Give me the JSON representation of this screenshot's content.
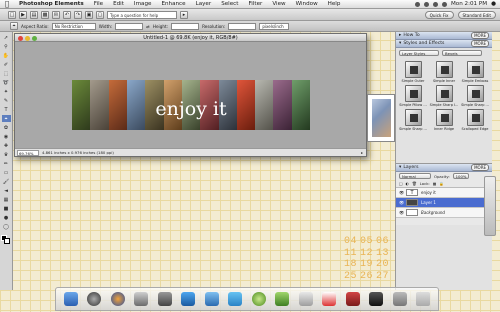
{
  "menubar": {
    "app_name": "Photoshop Elements",
    "items": [
      "File",
      "Edit",
      "Image",
      "Enhance",
      "Layer",
      "Select",
      "Filter",
      "View",
      "Window",
      "Help"
    ],
    "clock": "Mon 2:01 PM"
  },
  "shortcuts": {
    "help_placeholder": "Type a question for help",
    "quick_fix": "Quick Fix",
    "standard_edit": "Standard Edit"
  },
  "options_bar": {
    "aspect_ratio_label": "Aspect Ratio:",
    "aspect_ratio_value": "No Restriction",
    "width_label": "Width:",
    "height_label": "Height:",
    "resolution_label": "Resolution:",
    "resolution_unit": "pixels/inch",
    "clear_button": "Clear"
  },
  "document": {
    "title": "Untitled-1 @ 69.8K (enjoy it, RGB/8#)",
    "text_layer": "enjoy it",
    "zoom": "69.76%",
    "status_info": "4.861 inches x 0.976 inches (180 ppi)"
  },
  "how_to": {
    "title": "How To",
    "more": "MORE"
  },
  "styles_effects": {
    "title": "Styles and Effects",
    "more": "MORE",
    "category": "Layer Styles",
    "subcategory": "Bevels",
    "styles": [
      "Simple Outer",
      "Simple Inner",
      "Simple Emboss",
      "Simple Pillow ...",
      "Simple Sharp I...",
      "Simple Sharp ...",
      "Simple Sharp ...",
      "Inner Ridge",
      "Scalloped Edge"
    ]
  },
  "layers": {
    "title": "Layers",
    "more": "MORE",
    "blend_mode": "Normal",
    "opacity_label": "Opacity:",
    "opacity_value": "100%",
    "lock_label": "Lock:",
    "rows": [
      {
        "name": "enjoy it",
        "kind": "text"
      },
      {
        "name": "Layer 1",
        "kind": "pixel"
      },
      {
        "name": "Background",
        "kind": "background"
      }
    ]
  },
  "calendar": {
    "rows": [
      [
        "04",
        "05",
        "06"
      ],
      [
        "11",
        "12",
        "13"
      ],
      [
        "18",
        "19",
        "20"
      ],
      [
        "25",
        "26",
        "27"
      ]
    ],
    "color": "#e9b454"
  },
  "colors": {
    "selection": "#4a6cd0",
    "palette_header": "#a9b8d3",
    "canvas_gray": "#a8a8a8"
  }
}
